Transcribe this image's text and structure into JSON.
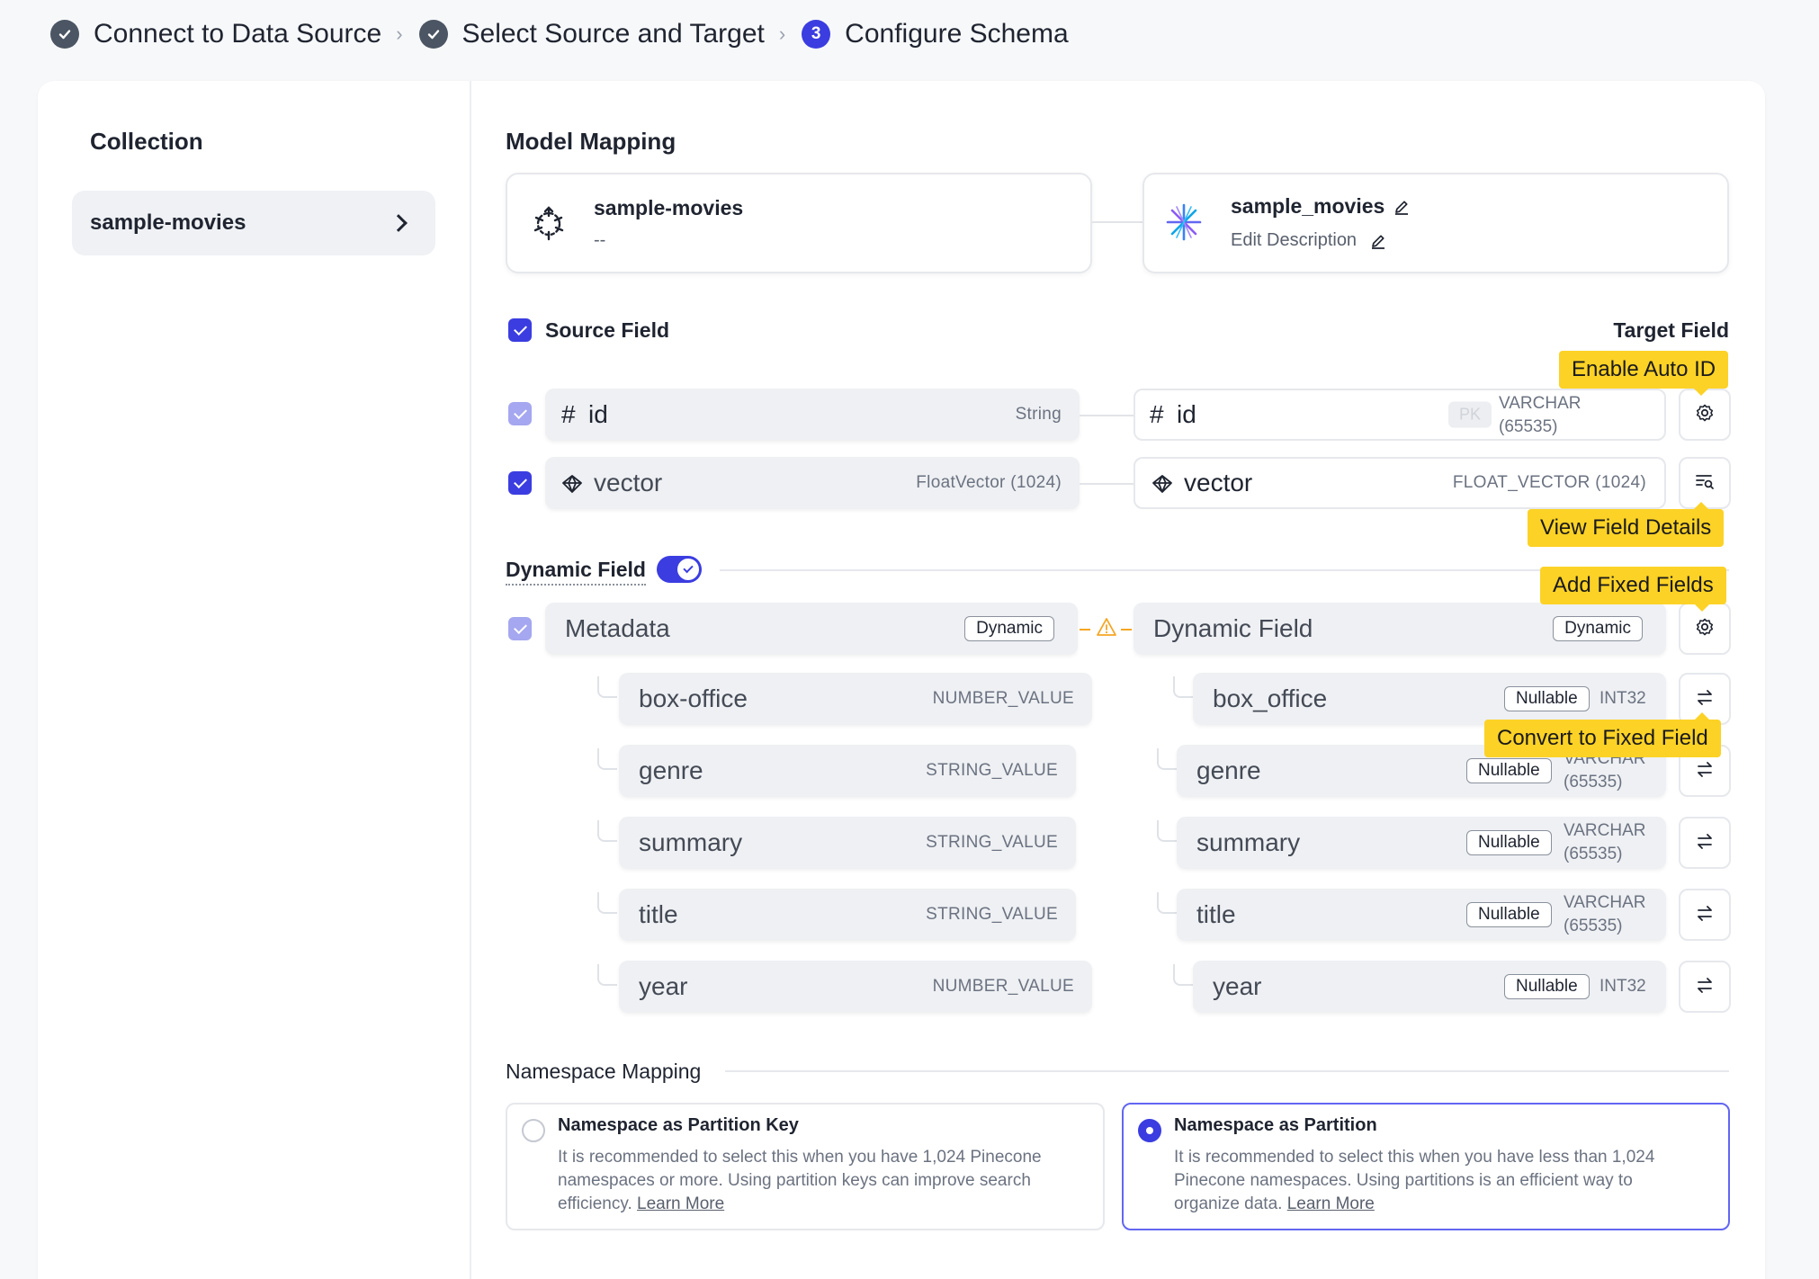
{
  "stepper": {
    "steps": [
      {
        "label": "Connect to Data Source",
        "state": "done",
        "number": ""
      },
      {
        "label": "Select Source and Target",
        "state": "done",
        "number": ""
      },
      {
        "label": "Configure Schema",
        "state": "active",
        "number": "3"
      }
    ]
  },
  "sidebar": {
    "title": "Collection",
    "items": [
      {
        "label": "sample-movies"
      }
    ]
  },
  "model_mapping": {
    "title": "Model Mapping",
    "source": {
      "name": "sample-movies",
      "description": "--"
    },
    "target": {
      "name": "sample_movies",
      "description": "Edit Description"
    }
  },
  "fields": {
    "source_header": "Source Field",
    "target_header": "Target Field",
    "rows": [
      {
        "source_name": "id",
        "source_type": "String",
        "target_name": "id",
        "target_badge": "PK",
        "target_type_line1": "VARCHAR",
        "target_type_line2": "(65535)"
      },
      {
        "source_name": "vector",
        "source_type": "FloatVector (1024)",
        "target_name": "vector",
        "target_type": "FLOAT_VECTOR (1024)"
      }
    ]
  },
  "dynamic": {
    "label": "Dynamic Field",
    "enabled": true,
    "source_name": "Metadata",
    "source_badge": "Dynamic",
    "target_name": "Dynamic Field",
    "target_badge": "Dynamic",
    "children": [
      {
        "source_name": "box-office",
        "source_type": "NUMBER_VALUE",
        "target_name": "box_office",
        "badge": "Nullable",
        "target_type_line1": "INT32",
        "target_type_line2": ""
      },
      {
        "source_name": "genre",
        "source_type": "STRING_VALUE",
        "target_name": "genre",
        "badge": "Nullable",
        "target_type_line1": "VARCHAR",
        "target_type_line2": "(65535)"
      },
      {
        "source_name": "summary",
        "source_type": "STRING_VALUE",
        "target_name": "summary",
        "badge": "Nullable",
        "target_type_line1": "VARCHAR",
        "target_type_line2": "(65535)"
      },
      {
        "source_name": "title",
        "source_type": "STRING_VALUE",
        "target_name": "title",
        "badge": "Nullable",
        "target_type_line1": "VARCHAR",
        "target_type_line2": "(65535)"
      },
      {
        "source_name": "year",
        "source_type": "NUMBER_VALUE",
        "target_name": "year",
        "badge": "Nullable",
        "target_type_line1": "INT32",
        "target_type_line2": ""
      }
    ]
  },
  "tooltips": {
    "enable_auto_id": "Enable Auto ID",
    "view_field_details": "View Field Details",
    "add_fixed_fields": "Add Fixed Fields",
    "convert_to_fixed_field": "Convert to Fixed Field"
  },
  "namespace": {
    "title": "Namespace Mapping",
    "options": [
      {
        "title": "Namespace as Partition Key",
        "desc_line1": "It is recommended to select this when you have 1,024 Pinecone",
        "desc_line2": "namespaces or more. Using partition keys can improve search",
        "desc_line3": "efficiency.",
        "link": "Learn More",
        "selected": false
      },
      {
        "title": "Namespace as Partition",
        "desc_line1": "It is recommended to select this when you have less than 1,024",
        "desc_line2": "Pinecone namespaces. Using partitions is an efficient way to",
        "desc_line3": "organize data.",
        "link": "Learn More",
        "selected": true
      }
    ]
  },
  "colors": {
    "accent": "#3b3de0",
    "tooltip": "#fcd226",
    "warning": "#f5a623"
  }
}
